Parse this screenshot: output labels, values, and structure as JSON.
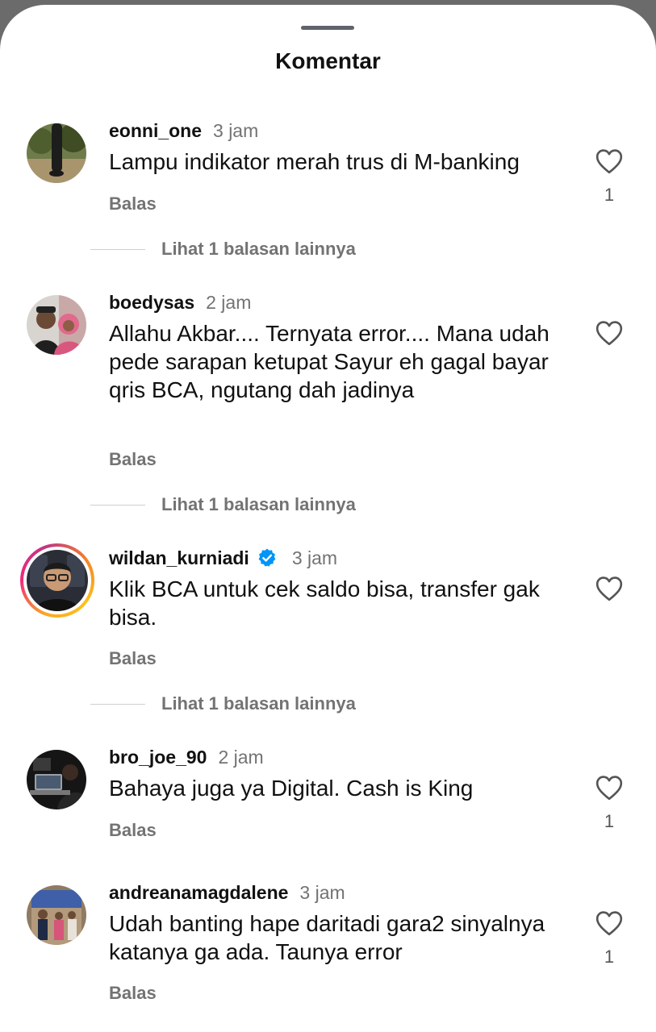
{
  "sheet": {
    "title": "Komentar"
  },
  "comments": [
    {
      "username": "eonni_one",
      "time": "3 jam",
      "text": "Lampu indikator merah trus di M-banking",
      "reply_label": "Balas",
      "likes": "1",
      "more_replies": "Lihat 1 balasan lainnya",
      "avatar": "avatar-photo-dark-figure"
    },
    {
      "username": "boedysas",
      "time": "2 jam",
      "text": "Allahu Akbar.... Ternyata error.... Mana udah pede sarapan ketupat Sayur eh gagal bayar qris BCA, ngutang dah jadinya",
      "reply_label": "Balas",
      "more_replies": "Lihat 1 balasan lainnya",
      "avatar": "avatar-photo-couple"
    },
    {
      "username": "wildan_kurniadi",
      "verified": true,
      "time": "3 jam",
      "text": "Klik BCA untuk cek saldo bisa, transfer gak bisa.",
      "reply_label": "Balas",
      "more_replies": "Lihat 1 balasan lainnya",
      "avatar": "avatar-photo-glasses-man"
    },
    {
      "username": "bro_joe_90",
      "time": "2 jam",
      "text": "Bahaya juga ya Digital. Cash is King",
      "reply_label": "Balas",
      "likes": "1",
      "avatar": "avatar-photo-laptop-dark"
    },
    {
      "username": "andreanamagdalene",
      "time": "3 jam",
      "text": "Udah banting hape daritadi gara2 sinyalnya katanya ga ada. Taunya error",
      "reply_label": "Balas",
      "likes": "1",
      "avatar": "avatar-photo-group-stage"
    }
  ],
  "colors": {
    "background_dim": "#6b6b6b",
    "sheet": "#ffffff",
    "text_primary": "#111111",
    "text_secondary": "#737373",
    "verified_blue": "#0095f6",
    "story_ring": [
      "#f9a825",
      "#ee2a7b",
      "#c13584"
    ]
  },
  "icons": {
    "like": "heart-outline-icon",
    "verified": "verified-badge-icon"
  }
}
